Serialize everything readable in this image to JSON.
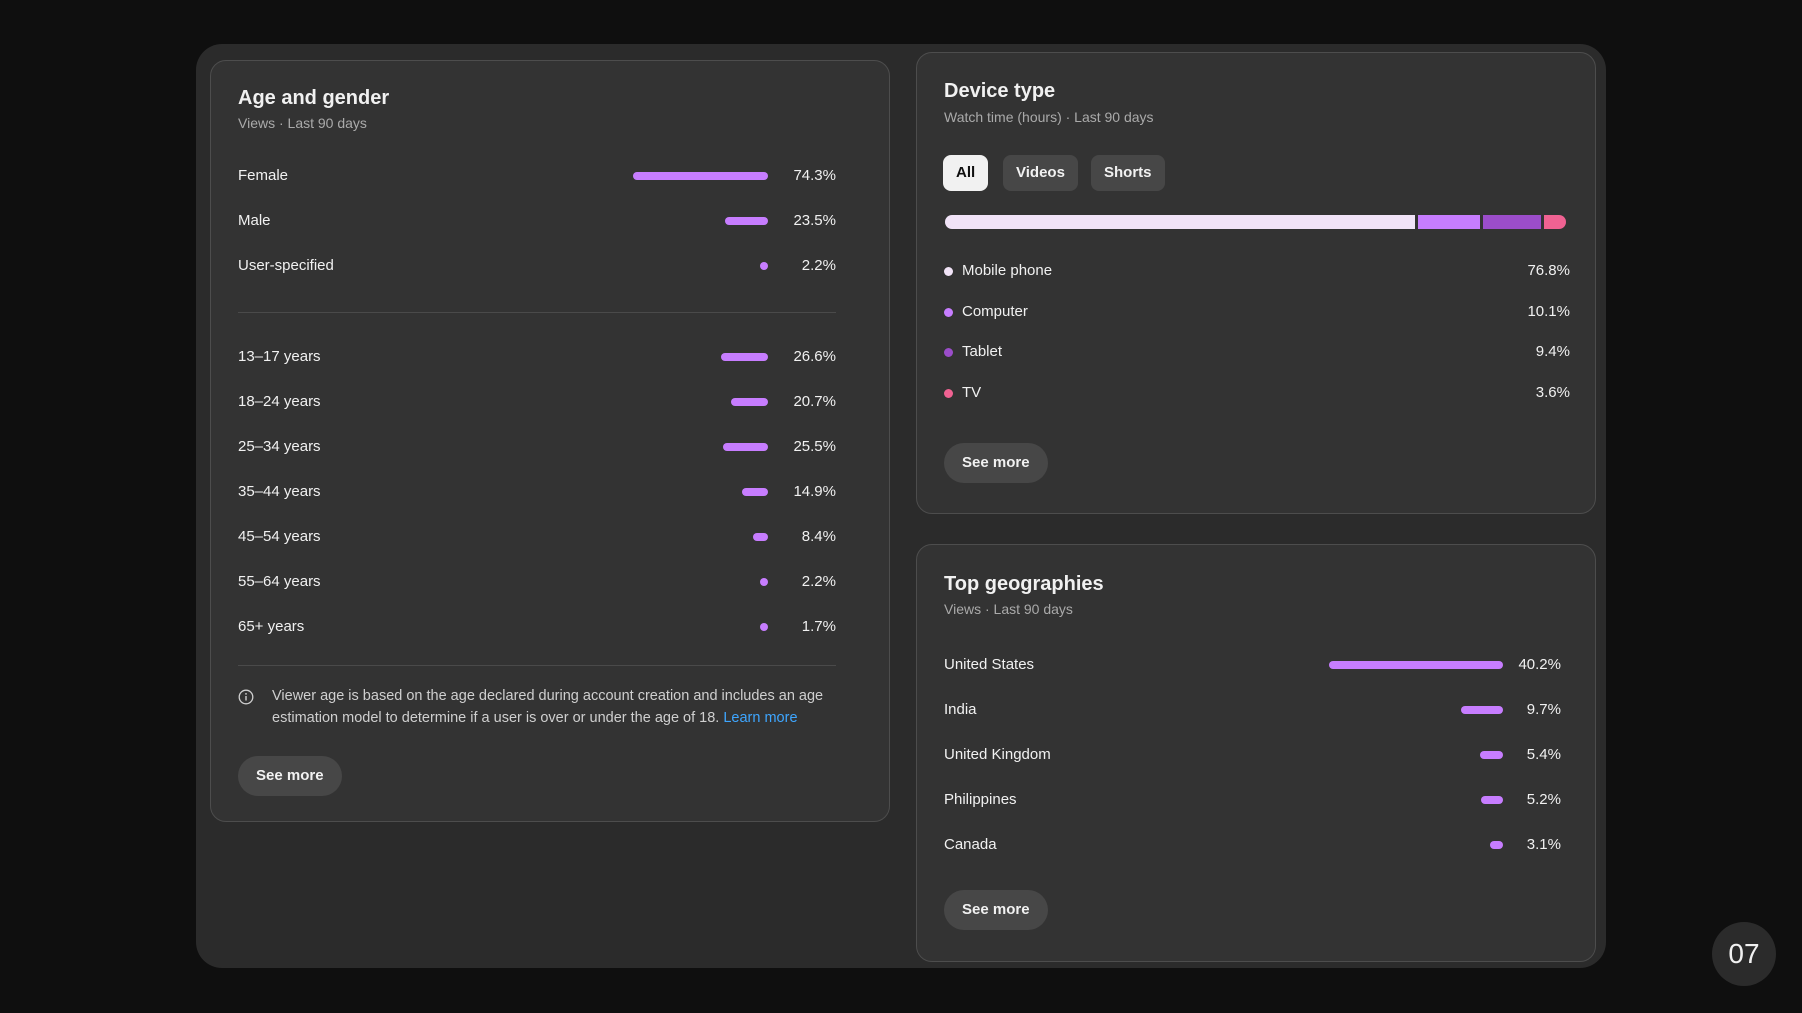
{
  "age_gender": {
    "title": "Age and gender",
    "subtitle": "Views · Last 90 days",
    "gender": [
      {
        "label": "Female",
        "value": "74.3%",
        "pct": 74.3
      },
      {
        "label": "Male",
        "value": "23.5%",
        "pct": 23.5
      },
      {
        "label": "User-specified",
        "value": "2.2%",
        "pct": 2.2
      }
    ],
    "ages": [
      {
        "label": "13–17 years",
        "value": "26.6%",
        "pct": 26.6
      },
      {
        "label": "18–24 years",
        "value": "20.7%",
        "pct": 20.7
      },
      {
        "label": "25–34 years",
        "value": "25.5%",
        "pct": 25.5
      },
      {
        "label": "35–44 years",
        "value": "14.9%",
        "pct": 14.9
      },
      {
        "label": "45–54 years",
        "value": "8.4%",
        "pct": 8.4
      },
      {
        "label": "55–64 years",
        "value": "2.2%",
        "pct": 2.2
      },
      {
        "label": "65+ years",
        "value": "1.7%",
        "pct": 1.7
      }
    ],
    "info_text": "Viewer age is based on the age declared during account creation and includes an age estimation model to determine if a user is over or under the age of 18.",
    "info_link": "Learn more",
    "see_more": "See more"
  },
  "device_type": {
    "title": "Device type",
    "subtitle": "Watch time (hours) · Last 90 days",
    "tabs": [
      {
        "label": "All",
        "active": true
      },
      {
        "label": "Videos",
        "active": false
      },
      {
        "label": "Shorts",
        "active": false
      }
    ],
    "devices": [
      {
        "label": "Mobile phone",
        "value": "76.8%",
        "pct": 76.8,
        "color": "#f1e3f7"
      },
      {
        "label": "Computer",
        "value": "10.1%",
        "pct": 10.1,
        "color": "#c77dff"
      },
      {
        "label": "Tablet",
        "value": "9.4%",
        "pct": 9.4,
        "color": "#9b4dca"
      },
      {
        "label": "TV",
        "value": "3.6%",
        "pct": 3.6,
        "color": "#f06292"
      }
    ],
    "see_more": "See more"
  },
  "geographies": {
    "title": "Top geographies",
    "subtitle": "Views · Last 90 days",
    "countries": [
      {
        "label": "United States",
        "value": "40.2%",
        "pct": 40.2
      },
      {
        "label": "India",
        "value": "9.7%",
        "pct": 9.7
      },
      {
        "label": "United Kingdom",
        "value": "5.4%",
        "pct": 5.4
      },
      {
        "label": "Philippines",
        "value": "5.2%",
        "pct": 5.2
      },
      {
        "label": "Canada",
        "value": "3.1%",
        "pct": 3.1
      }
    ],
    "see_more": "See more"
  },
  "colors": {
    "bar": "#c77dff",
    "link": "#3ea6ff"
  },
  "page_number": "07"
}
